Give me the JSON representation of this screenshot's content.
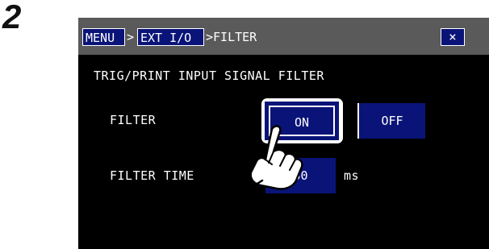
{
  "step": "2",
  "breadcrumb": {
    "menu_label": "MENU",
    "sep1": ">",
    "ext_label": "EXT I/O",
    "current": ">FILTER"
  },
  "close_label": "×",
  "heading": "TRIG/PRINT INPUT SIGNAL FILTER",
  "filter": {
    "label": "FILTER",
    "on_label": "ON",
    "off_label": "OFF",
    "selected": "ON"
  },
  "filter_time": {
    "label": "FILTER TIME",
    "value": "50",
    "unit": "ms"
  },
  "colors": {
    "screen_bg": "#000000",
    "title_bar": "#5a5a5a",
    "button_fill": "#0a1478",
    "text": "#ffffff"
  },
  "icons": {
    "pointer": "pointing-hand-icon"
  }
}
